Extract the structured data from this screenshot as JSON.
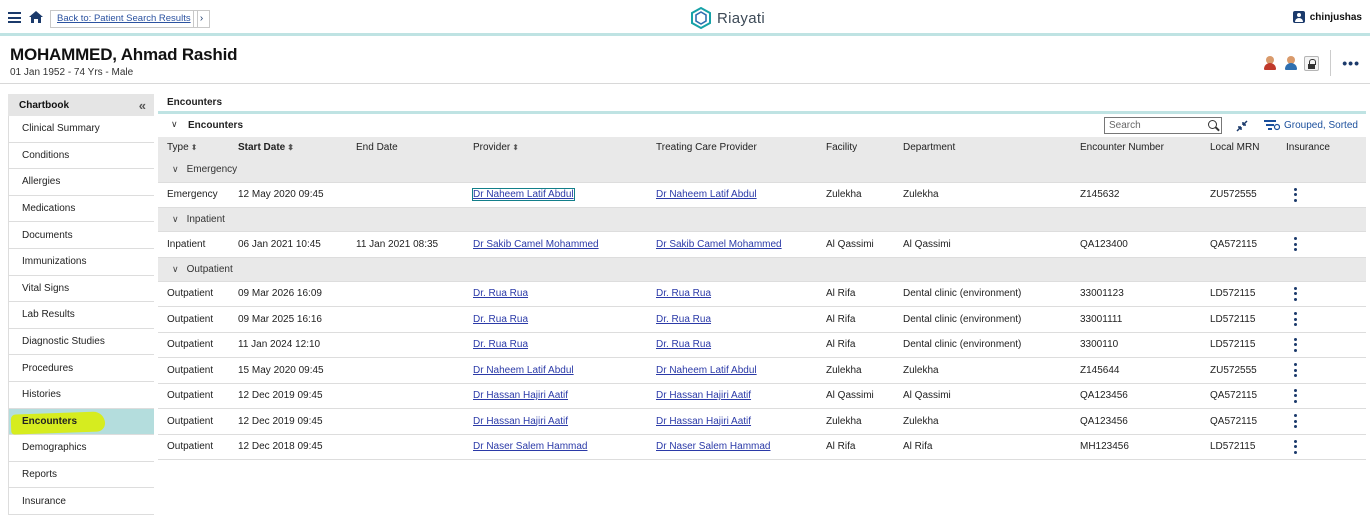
{
  "topbar": {
    "breadcrumb": "Back to: Patient Search Results",
    "breadcrumb_next": "›",
    "brand": "Riayati",
    "brand_sub": "",
    "user": "chinjushas"
  },
  "patient": {
    "name": "MOHAMMED, Ahmad Rashid",
    "info": "01 Jan 1952 - 74 Yrs - Male"
  },
  "sidebar": {
    "title": "Chartbook",
    "collapse": "«",
    "items": [
      {
        "label": "Clinical Summary"
      },
      {
        "label": "Conditions"
      },
      {
        "label": "Allergies"
      },
      {
        "label": "Medications"
      },
      {
        "label": "Documents"
      },
      {
        "label": "Immunizations"
      },
      {
        "label": "Vital Signs"
      },
      {
        "label": "Lab Results"
      },
      {
        "label": "Diagnostic Studies"
      },
      {
        "label": "Procedures"
      },
      {
        "label": "Histories"
      },
      {
        "label": "Encounters"
      },
      {
        "label": "Demographics"
      },
      {
        "label": "Reports"
      },
      {
        "label": "Insurance"
      }
    ]
  },
  "main": {
    "panel_title": "Encounters",
    "section_title": "Encounters",
    "search_placeholder": "Search",
    "grouped_label": "Grouped, Sorted",
    "columns": [
      "Type",
      "Start Date",
      "End Date",
      "Provider",
      "Treating Care Provider",
      "Facility",
      "Department",
      "Encounter Number",
      "Local MRN",
      "Insurance"
    ],
    "groups": [
      {
        "name": "Emergency",
        "rows": [
          {
            "type": "Emergency",
            "start": "12 May 2020 09:45",
            "end": "",
            "provider": "Dr Naheem Latif Abdul",
            "treating": "Dr Naheem Latif Abdul",
            "facility": "Zulekha",
            "department": "Zulekha",
            "encounter": "Z145632",
            "mrn": "ZU572555"
          }
        ]
      },
      {
        "name": "Inpatient",
        "rows": [
          {
            "type": "Inpatient",
            "start": "06 Jan 2021 10:45",
            "end": "11 Jan 2021 08:35",
            "provider": "Dr Sakib Camel Mohammed",
            "treating": "Dr Sakib Camel Mohammed",
            "facility": "Al Qassimi",
            "department": "Al Qassimi",
            "encounter": "QA123400",
            "mrn": "QA572115"
          }
        ]
      },
      {
        "name": "Outpatient",
        "rows": [
          {
            "type": "Outpatient",
            "start": "09 Mar 2026 16:09",
            "end": "",
            "provider": "Dr. Rua Rua",
            "treating": "Dr. Rua Rua",
            "facility": "Al Rifa",
            "department": "Dental clinic (environment)",
            "encounter": "33001123",
            "mrn": "LD572115"
          },
          {
            "type": "Outpatient",
            "start": "09 Mar 2025 16:16",
            "end": "",
            "provider": "Dr. Rua Rua",
            "treating": "Dr. Rua Rua",
            "facility": "Al Rifa",
            "department": "Dental clinic (environment)",
            "encounter": "33001111",
            "mrn": "LD572115"
          },
          {
            "type": "Outpatient",
            "start": "11 Jan 2024 12:10",
            "end": "",
            "provider": "Dr. Rua Rua",
            "treating": "Dr. Rua Rua",
            "facility": "Al Rifa",
            "department": "Dental clinic (environment)",
            "encounter": "3300110",
            "mrn": "LD572115"
          },
          {
            "type": "Outpatient",
            "start": "15 May 2020 09:45",
            "end": "",
            "provider": "Dr Naheem Latif Abdul",
            "treating": "Dr Naheem Latif Abdul",
            "facility": "Zulekha",
            "department": "Zulekha",
            "encounter": "Z145644",
            "mrn": "ZU572555"
          },
          {
            "type": "Outpatient",
            "start": "12 Dec 2019 09:45",
            "end": "",
            "provider": "Dr Hassan Hajiri Aatif",
            "treating": "Dr Hassan Hajiri Aatif",
            "facility": "Al Qassimi",
            "department": "Al Qassimi",
            "encounter": "QA123456",
            "mrn": "QA572115"
          },
          {
            "type": "Outpatient",
            "start": "12 Dec 2019 09:45",
            "end": "",
            "provider": "Dr Hassan Hajiri Aatif",
            "treating": "Dr Hassan Hajiri Aatif",
            "facility": "Zulekha",
            "department": "Zulekha",
            "encounter": "QA123456",
            "mrn": "QA572115"
          },
          {
            "type": "Outpatient",
            "start": "12 Dec 2018 09:45",
            "end": "",
            "provider": "Dr Naser Salem Hammad",
            "treating": "Dr Naser Salem Hammad",
            "facility": "Al Rifa",
            "department": "Al Rifa",
            "encounter": "MH123456",
            "mrn": "LD572115"
          }
        ]
      }
    ]
  },
  "colors": {
    "accent": "#bfe3e3",
    "active_item": "#b4dddd",
    "highlight": "#d6ec1f",
    "link": "#2b3aa8",
    "icon": "#1b3a6b"
  }
}
